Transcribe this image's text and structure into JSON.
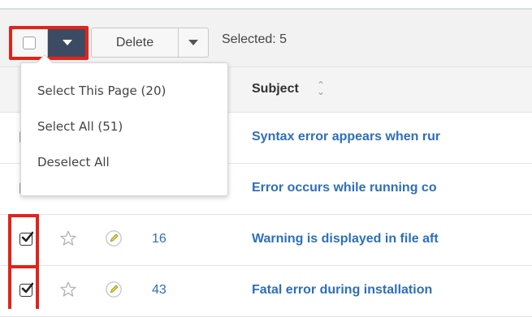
{
  "toolbar": {
    "delete_label": "Delete",
    "selected_text": "Selected: 5"
  },
  "menu": {
    "items": [
      "Select This Page (20)",
      "Select All (51)",
      "Deselect All"
    ]
  },
  "table": {
    "columns": {
      "subject": "Subject"
    },
    "rows": [
      {
        "checked": false,
        "number": "",
        "subject": "Syntax error appears when rur"
      },
      {
        "checked": false,
        "number": "",
        "subject": "Error occurs while running co"
      },
      {
        "checked": true,
        "number": "16",
        "subject": "Warning is displayed in file aft"
      },
      {
        "checked": true,
        "number": "43",
        "subject": "Fatal error during installation"
      }
    ]
  },
  "colors": {
    "accent_dark": "#3c4b64",
    "link": "#2e6fb8",
    "highlight": "#e2231a",
    "pencil": "#d4c200"
  },
  "icons": [
    "checkbox-icon",
    "chevron-down-icon",
    "sort-icon",
    "star-icon",
    "pencil-icon",
    "check-icon"
  ]
}
